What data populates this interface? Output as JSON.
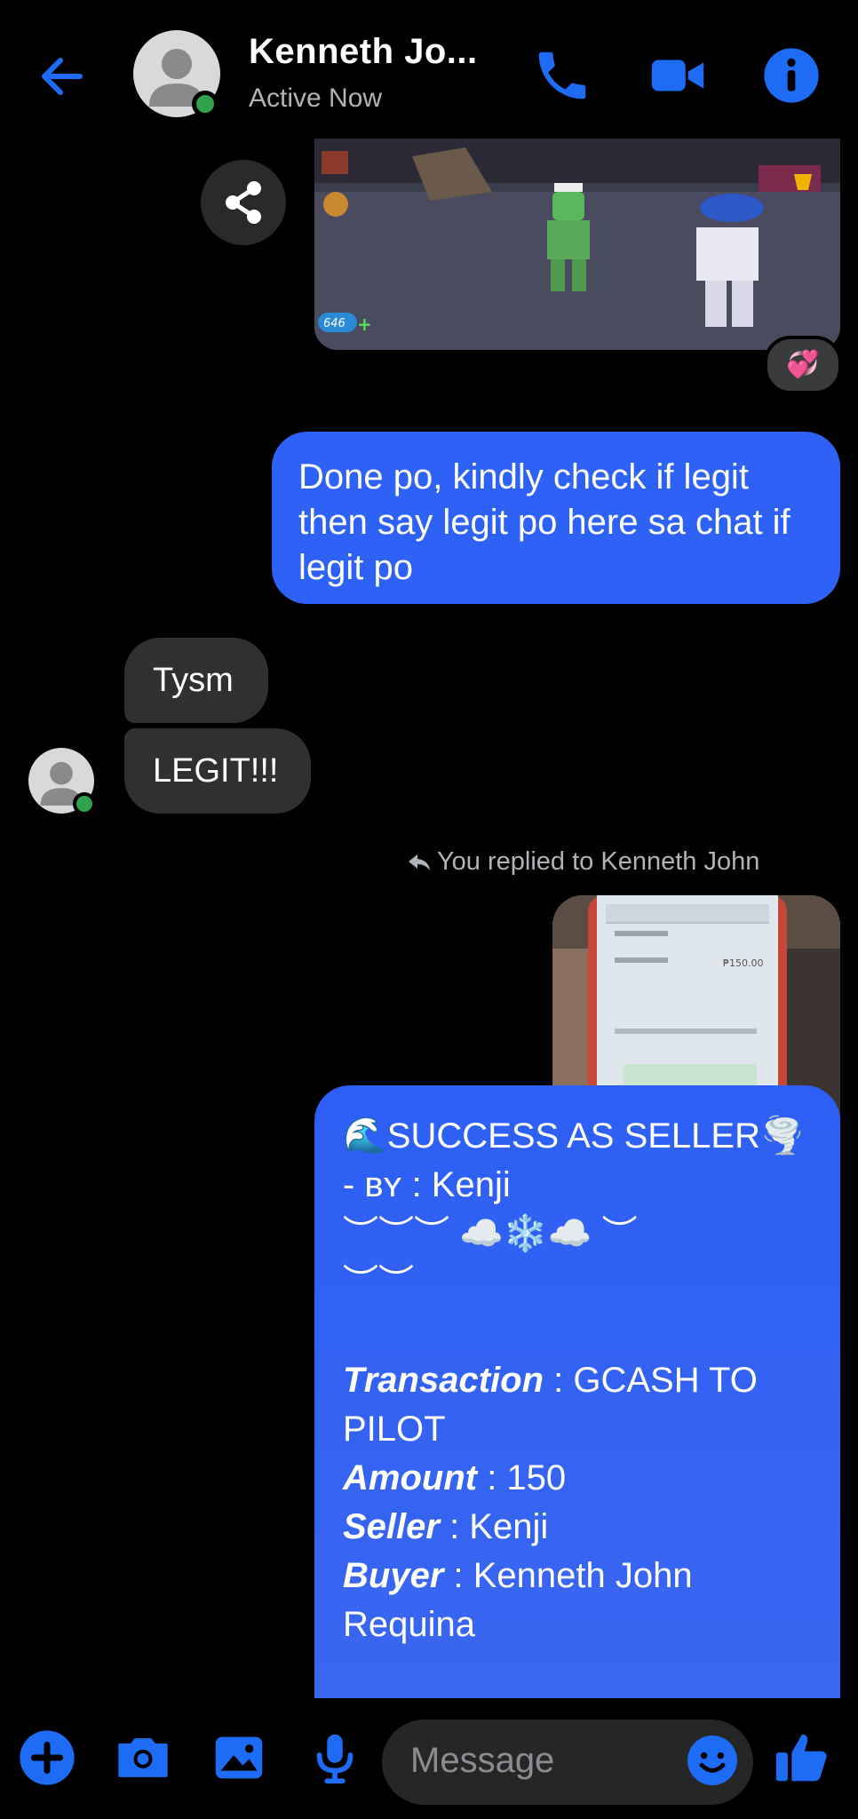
{
  "header": {
    "name": "Kenneth Jo...",
    "status": "Active Now",
    "icons": [
      "back-arrow-icon",
      "phone-icon",
      "video-icon",
      "info-icon"
    ]
  },
  "thread": {
    "top_image": {
      "reaction": "💞",
      "game_hud_count": "646"
    },
    "outgoing_1": "Done po, kindly check if legit then say legit po here sa chat if legit po",
    "incoming_1": "Tysm",
    "incoming_2": "LEGIT!!!",
    "reply_note": "You replied to Kenneth John",
    "receipt_amount": "₱150.00",
    "outgoing_2": {
      "line1": "🌊SUCCESS AS SELLER🌪️",
      "line2": "- ʙʏ : Kenji",
      "line3": "︶︶︶ ☁️❄️☁️ ︶",
      "line4": "︶︶",
      "transaction_label": "Transaction",
      "transaction_value": " : GCASH TO PILOT",
      "amount_label": "Amount",
      "amount_value": " : 150",
      "seller_label": "Seller",
      "seller_value": " : Kenji",
      "buyer_label": "Buyer",
      "buyer_value": " : Kenneth John Requina"
    }
  },
  "composer": {
    "placeholder": "Message",
    "icons": [
      "plus-icon",
      "camera-icon",
      "gallery-icon",
      "microphone-icon",
      "emoji-icon",
      "thumbs-up-icon"
    ]
  },
  "colors": {
    "accent": "#2e62f6",
    "icon_blue": "#1e6bf5",
    "online": "#31a24c",
    "incoming_bubble": "#303030",
    "background": "#000000"
  }
}
